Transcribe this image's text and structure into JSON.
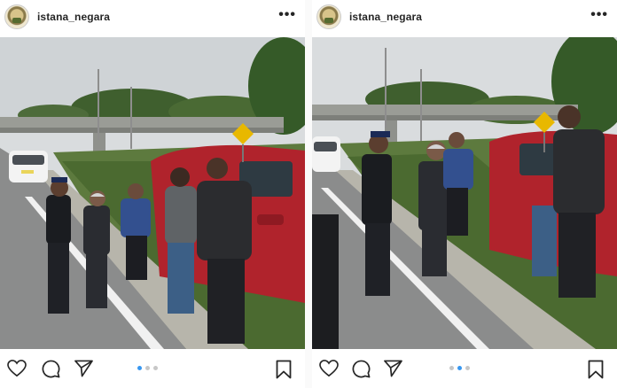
{
  "posts": [
    {
      "username": "istana_negara",
      "more_label": "•••",
      "carousel": {
        "count": 3,
        "active": 0
      }
    },
    {
      "username": "istana_negara",
      "more_label": "•••",
      "carousel": {
        "count": 3,
        "active": 1
      }
    }
  ],
  "icons": {
    "like": "heart-icon",
    "comment": "comment-icon",
    "share": "send-icon",
    "save": "bookmark-icon",
    "more": "more-options-icon"
  },
  "colors": {
    "accent": "#3897f0",
    "inactive_dot": "#c7c7c7",
    "car": "#b0232c",
    "text": "#262626"
  }
}
